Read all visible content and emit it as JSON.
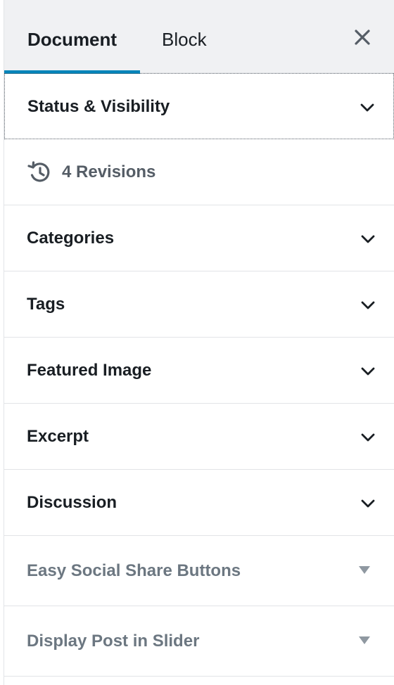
{
  "tabs": {
    "document": "Document",
    "block": "Block"
  },
  "close_icon": "close-icon",
  "colors": {
    "active_tab_underline": "#0085ba",
    "header_bg": "#f0f1f3",
    "muted_text": "#6c7781",
    "revisions_text": "#555d66"
  },
  "panels": [
    {
      "label": "Status & Visibility",
      "icon": "chevron-down-icon"
    },
    {
      "label": "4 Revisions",
      "icon": "history-icon"
    },
    {
      "label": "Categories",
      "icon": "chevron-down-icon"
    },
    {
      "label": "Tags",
      "icon": "chevron-down-icon"
    },
    {
      "label": "Featured Image",
      "icon": "chevron-down-icon"
    },
    {
      "label": "Excerpt",
      "icon": "chevron-down-icon"
    },
    {
      "label": "Discussion",
      "icon": "chevron-down-icon"
    },
    {
      "label": "Easy Social Share Buttons",
      "icon": "caret-down-icon"
    },
    {
      "label": "Display Post in Slider",
      "icon": "caret-down-icon"
    }
  ]
}
